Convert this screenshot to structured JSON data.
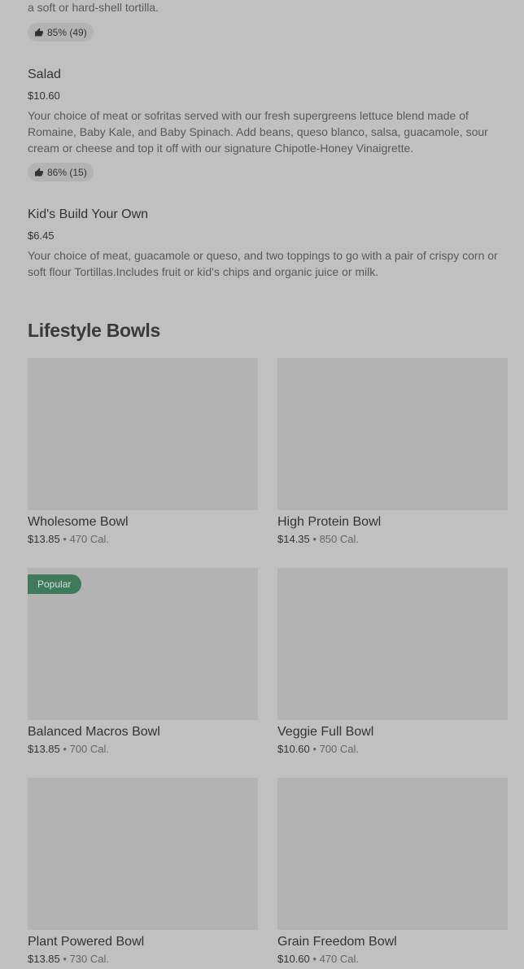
{
  "top_item": {
    "desc_tail": "a soft or hard-shell tortilla.",
    "rating": "85% (49)"
  },
  "salad": {
    "title": "Salad",
    "price": "$10.60",
    "desc": "Your choice of meat or sofritas served with our fresh supergreens lettuce blend made of Romaine, Baby Kale, and Baby Spinach. Add beans, queso blanco, salsa, guacamole, sour cream or cheese and top it off with our signature Chipotle-Honey Vinaigrette.",
    "rating": "86% (15)"
  },
  "kids": {
    "title": "Kid's Build Your Own",
    "price": "$6.45",
    "desc": "Your choice of meat, guacamole or queso, and two toppings to go with a pair of crispy corn or soft flour Tortillas.Includes fruit or kid's chips and organic juice or milk."
  },
  "section": {
    "title": "Lifestyle Bowls"
  },
  "bowls": [
    {
      "name": "Wholesome Bowl",
      "price": "$13.85",
      "cal": "470 Cal.",
      "badge": ""
    },
    {
      "name": "High Protein Bowl",
      "price": "$14.35",
      "cal": "850 Cal.",
      "badge": ""
    },
    {
      "name": "Balanced Macros Bowl",
      "price": "$13.85",
      "cal": "700 Cal.",
      "badge": "Popular"
    },
    {
      "name": "Veggie Full Bowl",
      "price": "$10.60",
      "cal": "700 Cal.",
      "badge": ""
    },
    {
      "name": "Plant Powered Bowl",
      "price": "$13.85",
      "cal": "730 Cal.",
      "badge": ""
    },
    {
      "name": "Grain Freedom Bowl",
      "price": "$10.60",
      "cal": "470 Cal.",
      "badge": ""
    }
  ],
  "separator": "•",
  "icons": {
    "rating": "thumbs-up-icon"
  },
  "colors": {
    "background": "#c0c0c0",
    "image_placeholder": "#b3b3b3",
    "popular_badge": "#3f7a5a"
  }
}
